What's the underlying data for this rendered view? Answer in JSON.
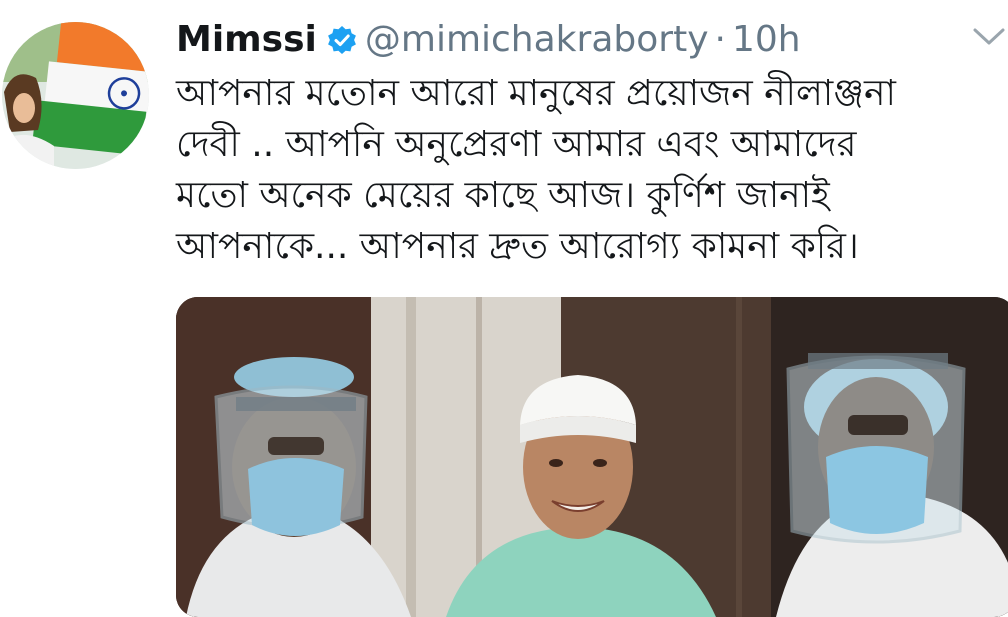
{
  "tweet": {
    "author": {
      "display_name": "Mimssi",
      "handle": "@mimichakraborty",
      "verified": true
    },
    "separator": "·",
    "time": "10h",
    "text_lines": [
      "আপনার মতোন আরো মানুষের প্রয়োজন নীলাঞ্জনা",
      "দেবী .. আপনি অনুপ্রেরণা আমার এবং আমাদের",
      "মতো অনেক মেয়ের কাছে আজ। কুর্ণিশ জানাই",
      "আপনাকে... আপনার দ্রুত আরোগ্য কামনা করি।"
    ],
    "icons": {
      "verified": "verified-badge-icon",
      "menu": "chevron-down-icon"
    },
    "colors": {
      "verified": "#1da1f2",
      "secondary_text": "#657786",
      "primary_text": "#14171a"
    }
  }
}
